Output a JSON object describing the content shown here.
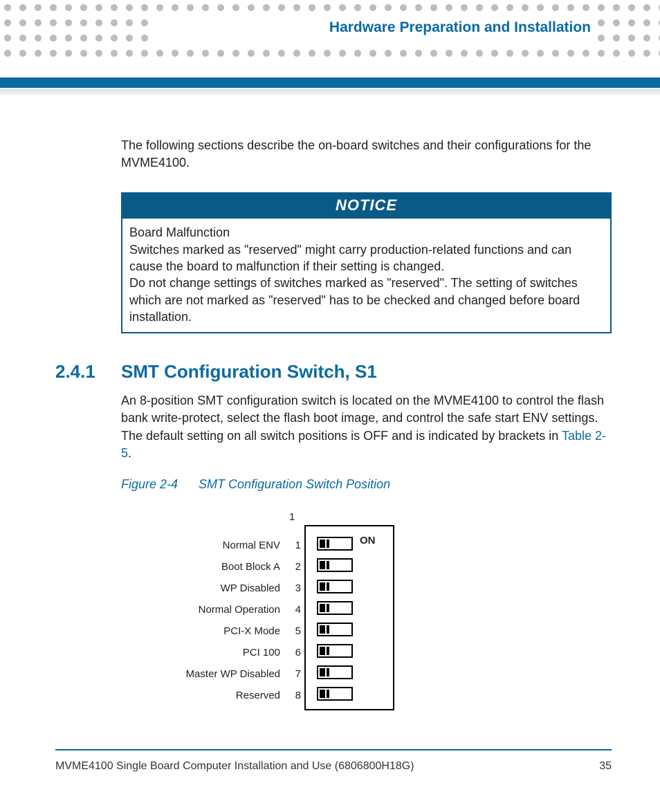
{
  "header": {
    "chapter_title": "Hardware Preparation and Installation"
  },
  "intro": "The following sections describe the on-board switches and their configurations for the MVME4100.",
  "notice": {
    "label": "NOTICE",
    "line1": "Board Malfunction",
    "line2": "Switches marked as \"reserved\" might carry production-related functions and can cause the board to malfunction if their setting is changed.",
    "line3": "Do not change settings of switches marked as \"reserved\". The setting of switches which are not marked as \"reserved\" has to be checked and changed before board installation."
  },
  "section": {
    "number": "2.4.1",
    "title": "SMT Configuration Switch, S1",
    "body_pre": "An 8-position SMT configuration switch is located on the MVME4100 to control the flash bank write-protect, select the flash boot image, and control the safe start ENV settings. The default setting on all switch positions is OFF and is indicated by brackets in ",
    "body_ref": "Table 2-5",
    "body_post": "."
  },
  "figure": {
    "number": "Figure 2-4",
    "title": "SMT Configuration Switch Position",
    "top_pin": "1",
    "on_label": "ON",
    "rows": [
      {
        "idx": "1",
        "label": "Normal ENV"
      },
      {
        "idx": "2",
        "label": "Boot Block A"
      },
      {
        "idx": "3",
        "label": "WP Disabled"
      },
      {
        "idx": "4",
        "label": "Normal Operation"
      },
      {
        "idx": "5",
        "label": "PCI-X Mode"
      },
      {
        "idx": "6",
        "label": "PCI 100"
      },
      {
        "idx": "7",
        "label": "Master WP Disabled"
      },
      {
        "idx": "8",
        "label": "Reserved"
      }
    ]
  },
  "footer": {
    "doc": "MVME4100 Single Board Computer Installation and Use (6806800H18G)",
    "page": "35"
  }
}
